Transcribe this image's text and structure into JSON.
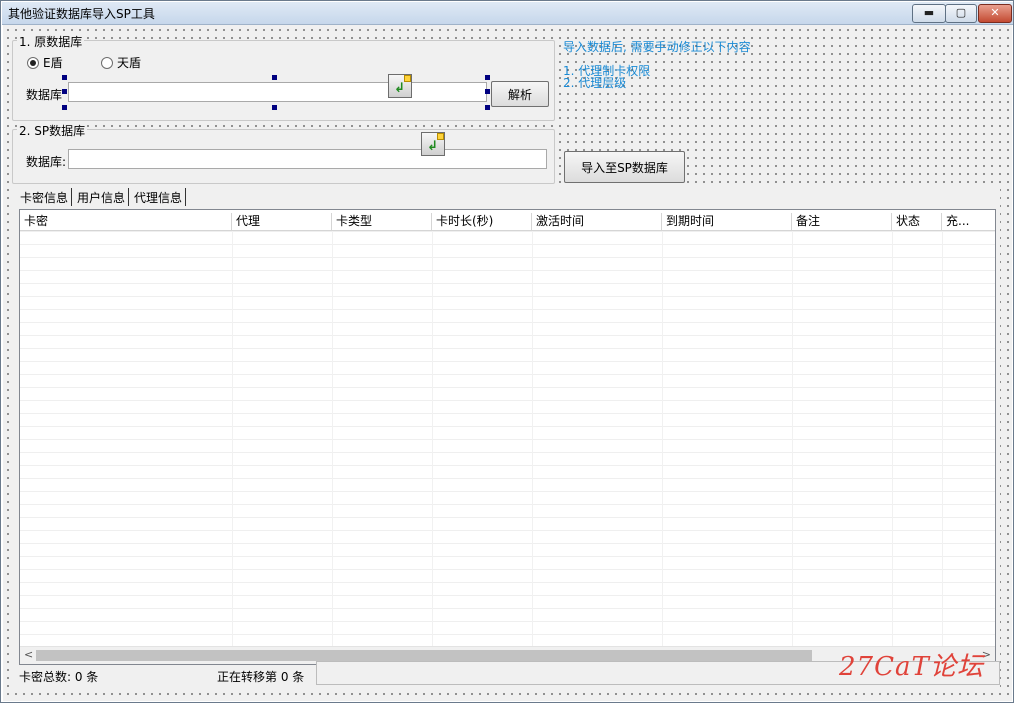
{
  "window": {
    "title": "其他验证数据库导入SP工具",
    "controls": {
      "minimize": "▬",
      "maximize": "▢",
      "close": "✕"
    }
  },
  "source_group": {
    "legend": "1. 原数据库",
    "radio_options": [
      {
        "label": "E盾",
        "selected": true
      },
      {
        "label": "天盾",
        "selected": false
      }
    ],
    "db_label": "数据库",
    "db_value": "",
    "parse_button": "解析"
  },
  "sp_group": {
    "legend": "2. SP数据库",
    "db_label": "数据库:",
    "db_value": ""
  },
  "import_button": "导入至SP数据库",
  "notes": {
    "heading": "导入数据后, 需要手动修正以下内容",
    "items": [
      "1. 代理制卡权限",
      "2. 代理层级"
    ]
  },
  "tabs": [
    {
      "label": "卡密信息",
      "active": true
    },
    {
      "label": "用户信息",
      "active": false
    },
    {
      "label": "代理信息",
      "active": false
    }
  ],
  "grid": {
    "columns": [
      "卡密",
      "代理",
      "卡类型",
      "卡时长(秒)",
      "激活时间",
      "到期时间",
      "备注",
      "状态",
      "充..."
    ],
    "rows": []
  },
  "status": {
    "total_cards": "卡密总数: 0 条",
    "transferring": "正在转移第 0 条",
    "progress": 0
  },
  "watermark": "27CaT论坛",
  "colors": {
    "note": "#1a8ad4",
    "selection_handle": "#000080",
    "watermark": "#e0433a"
  }
}
